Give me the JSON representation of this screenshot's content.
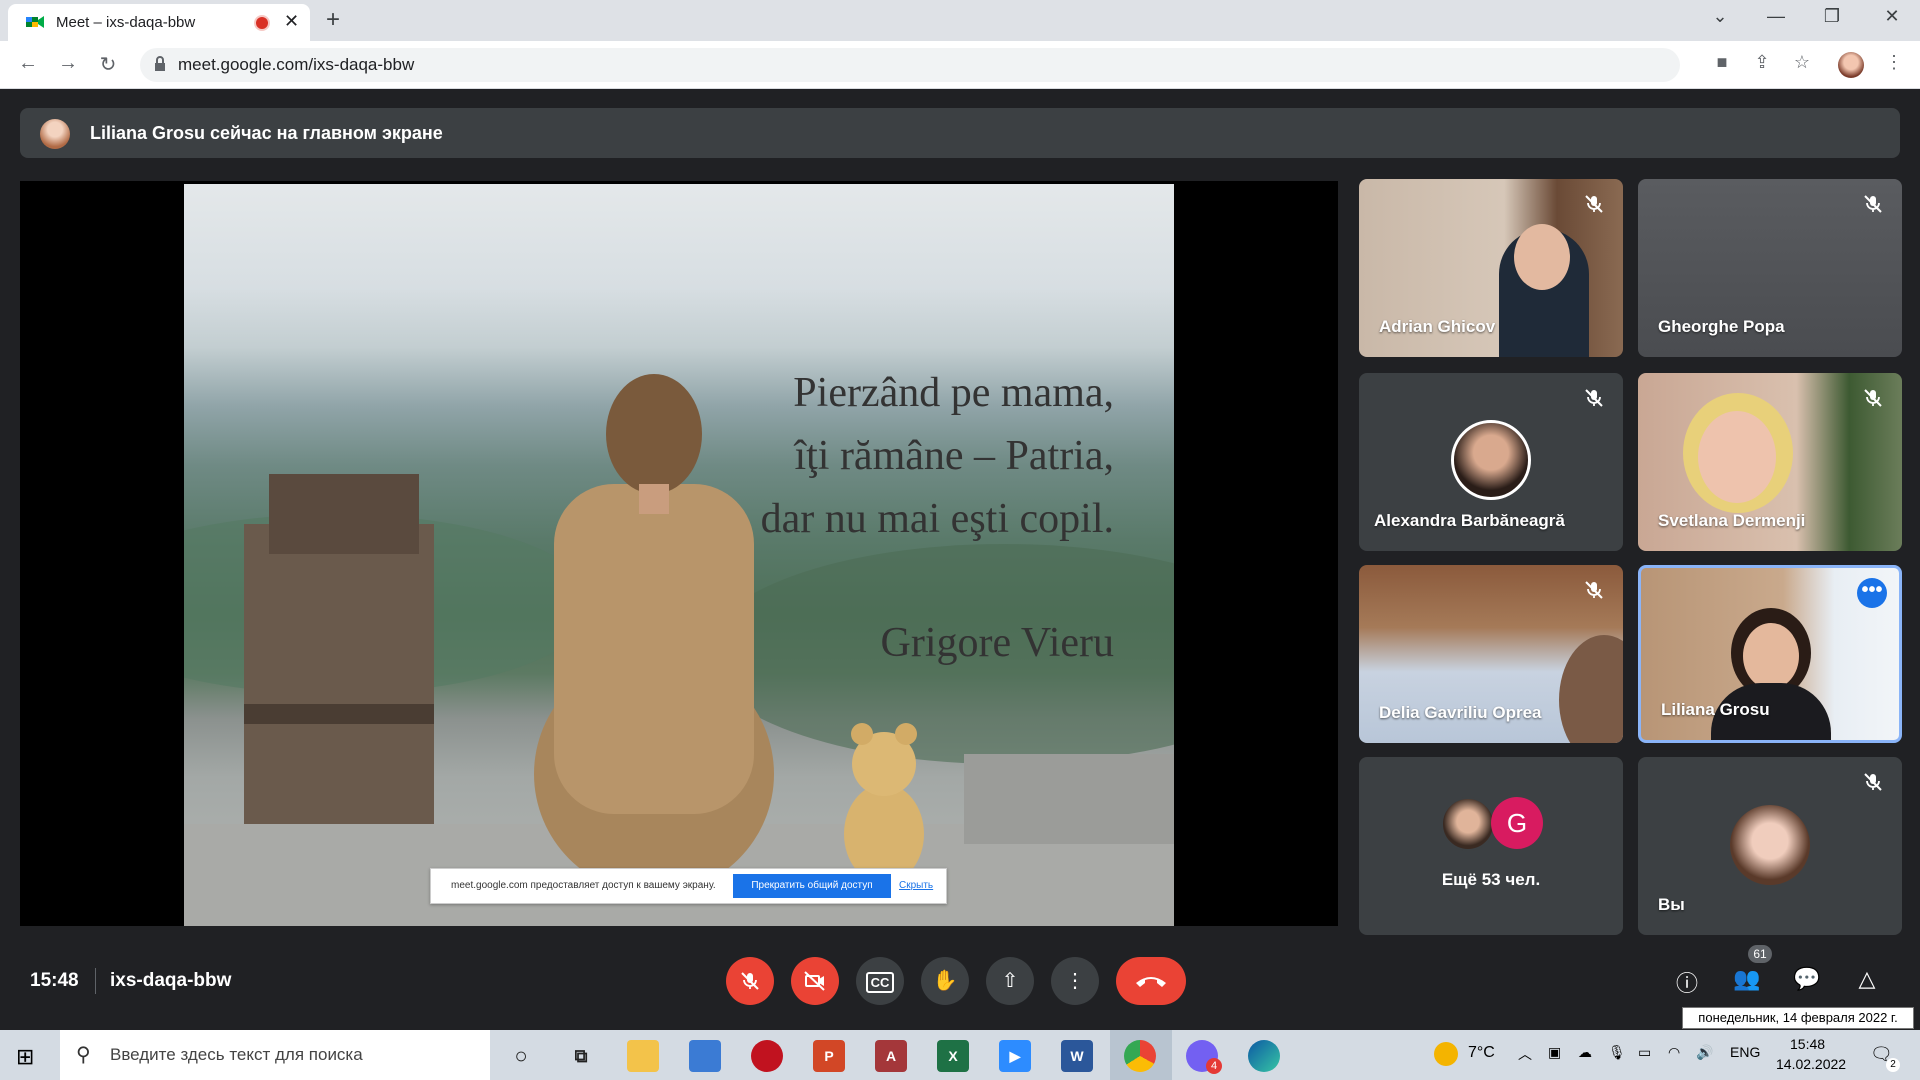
{
  "browser": {
    "tab_title": "Meet – ixs-daqa-bbw",
    "url": "meet.google.com/ixs-daqa-bbw"
  },
  "banner": {
    "text": "Liliana Grosu сейчас на главном экране"
  },
  "slide": {
    "lines": [
      "Pierzând pe mama,",
      "îţi rămâne – Patria,",
      "dar nu mai eşti copil."
    ],
    "author": "Grigore Vieru"
  },
  "share_notice": {
    "text": "meet.google.com предоставляет доступ к вашему экрану.",
    "stop_label": "Прекратить общий доступ",
    "hide_label": "Скрыть"
  },
  "participants": [
    {
      "name": "Adrian Ghicov",
      "muted": true
    },
    {
      "name": "Gheorghe Popa",
      "muted": true
    },
    {
      "name": "Alexandra Barbăneagră",
      "muted": true
    },
    {
      "name": "Svetlana Dermenji",
      "muted": true
    },
    {
      "name": "Delia Gavriliu Oprea",
      "muted": true
    },
    {
      "name": "Liliana Grosu",
      "muted": false
    },
    {
      "name": "Ещё 53 чел.",
      "avatar_letter": "G"
    },
    {
      "name": "Вы",
      "muted": true
    }
  ],
  "meeting": {
    "time": "15:48",
    "code": "ixs-daqa-bbw",
    "participant_count": "61"
  },
  "colors": {
    "meet_bg": "#202124",
    "tile_bg": "#3c4043",
    "danger": "#ea4335",
    "accent": "#1a73e8"
  },
  "taskbar": {
    "search_placeholder": "Введите здесь текст для поиска",
    "temperature": "7°C",
    "lang": "ENG",
    "time": "15:48",
    "date": "14.02.2022",
    "notifications": "2",
    "viber_badge": "4"
  },
  "tooltip": "понедельник, 14 февраля 2022 г."
}
